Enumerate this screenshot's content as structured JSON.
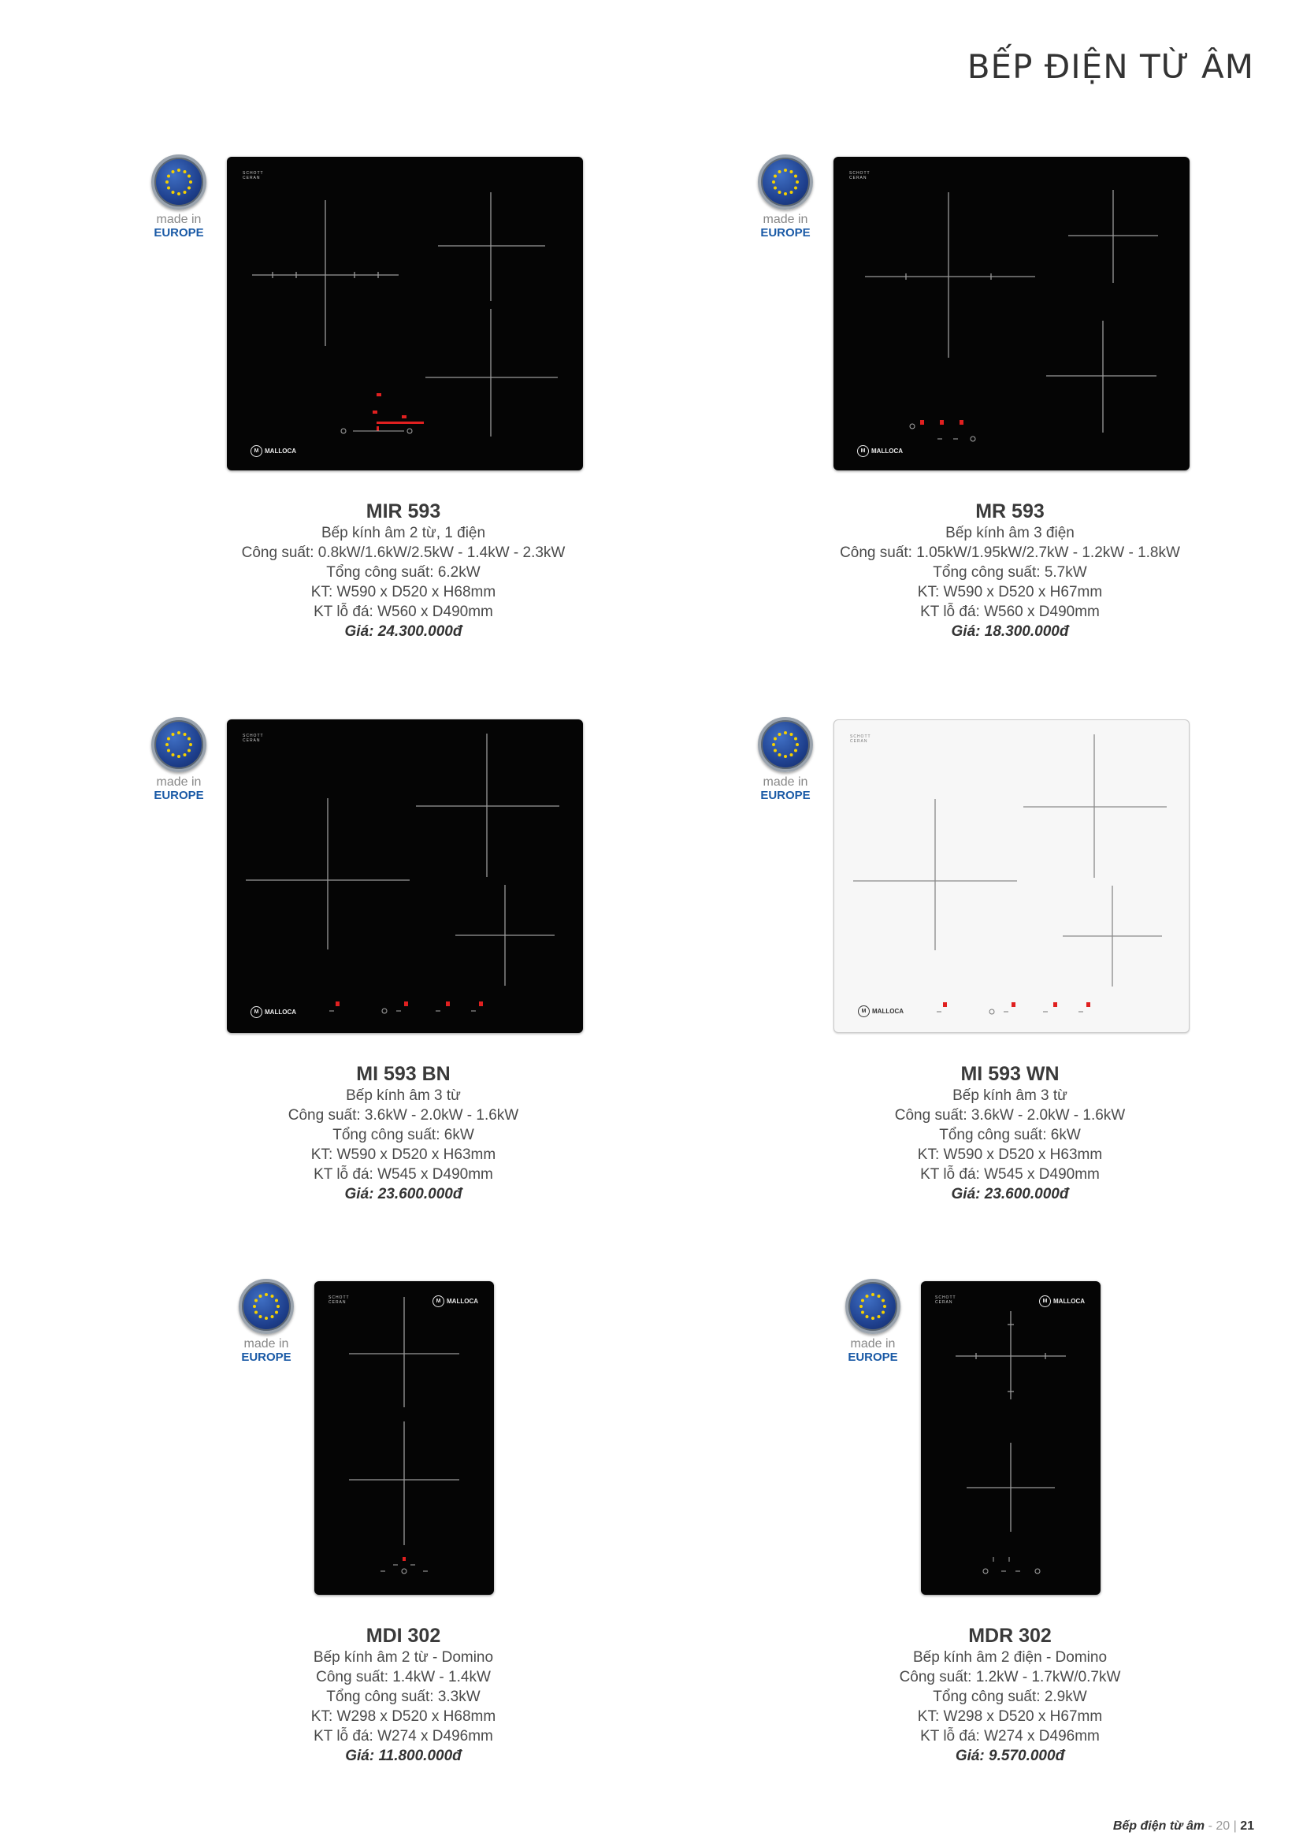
{
  "page": {
    "title": "BẾP ĐIỆN TỪ ÂM"
  },
  "badge": {
    "made_in": "made in",
    "region": "EUROPE"
  },
  "hob_text": {
    "schott": "SCHOTT",
    "ceran": "CERAN",
    "brand": "MALLOCA",
    "logo_letter": "M"
  },
  "products": [
    {
      "model": "MIR 593",
      "type": "Bếp kính âm 2 từ, 1 điện",
      "power": "Công suất: 0.8kW/1.6kW/2.5kW - 1.4kW - 2.3kW",
      "total_power": "Tổng công suất: 6.2kW",
      "dimensions": "KT: W590 x D520 x H68mm",
      "cutout": "KT lỗ đá: W560 x D490mm",
      "price": "Giá: 24.300.000đ"
    },
    {
      "model": "MR 593",
      "type": "Bếp kính âm 3 điện",
      "power": "Công suất: 1.05kW/1.95kW/2.7kW - 1.2kW - 1.8kW",
      "total_power": "Tổng công suất: 5.7kW",
      "dimensions": "KT: W590 x D520 x H67mm",
      "cutout": "KT lỗ đá: W560 x D490mm",
      "price": "Giá: 18.300.000đ"
    },
    {
      "model": "MI 593 BN",
      "type": "Bếp kính âm 3 từ",
      "power": "Công suất: 3.6kW - 2.0kW - 1.6kW",
      "total_power": "Tổng công suất: 6kW",
      "dimensions": "KT: W590 x D520 x H63mm",
      "cutout": "KT lỗ đá: W545 x D490mm",
      "price": "Giá: 23.600.000đ"
    },
    {
      "model": "MI 593 WN",
      "type": "Bếp kính âm 3 từ",
      "power": "Công suất: 3.6kW - 2.0kW - 1.6kW",
      "total_power": "Tổng công suất: 6kW",
      "dimensions": "KT: W590 x D520 x H63mm",
      "cutout": "KT lỗ đá: W545 x D490mm",
      "price": "Giá: 23.600.000đ"
    },
    {
      "model": "MDI 302",
      "type": "Bếp kính âm 2 từ - Domino",
      "power": "Công suất: 1.4kW - 1.4kW",
      "total_power": "Tổng công suất: 3.3kW",
      "dimensions": "KT: W298 x D520 x H68mm",
      "cutout": "KT lỗ đá: W274 x D496mm",
      "price": "Giá: 11.800.000đ"
    },
    {
      "model": "MDR 302",
      "type": "Bếp kính âm 2 điện - Domino",
      "power": "Công suất: 1.2kW - 1.7kW/0.7kW",
      "total_power": "Tổng công suất: 2.9kW",
      "dimensions": "KT: W298 x D520 x H67mm",
      "cutout": "KT lỗ đá: W274 x D496mm",
      "price": "Giá: 9.570.000đ"
    }
  ],
  "footer": {
    "section": "Bếp điện từ âm",
    "sep": " - ",
    "page_left": "20",
    "divider": " | ",
    "page_right": "21"
  },
  "colors": {
    "brand_blue": "#1a5aa6",
    "display_red": "#e02020"
  }
}
